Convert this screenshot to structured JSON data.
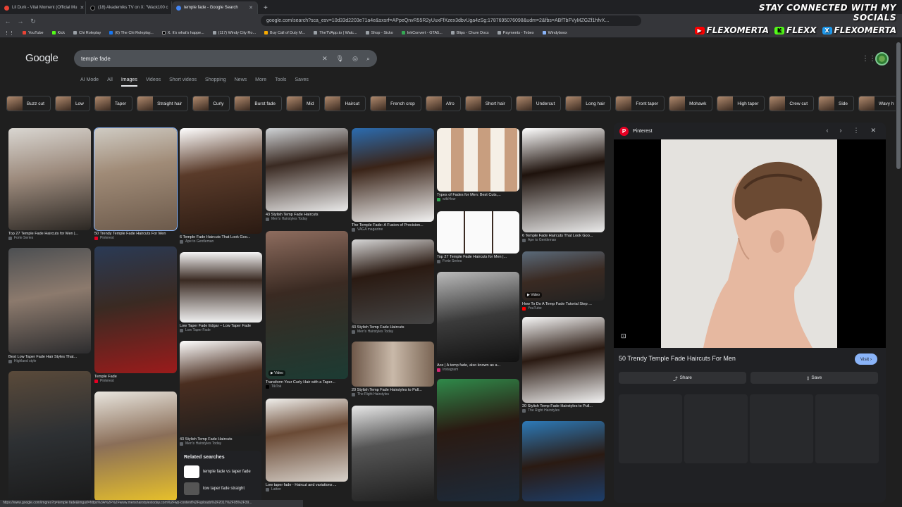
{
  "browser": {
    "tabs": [
      {
        "title": "Lil Durk - Vital Moment (Official Mu",
        "icon": "youtube-icon"
      },
      {
        "title": "(18) Akademiks TV on X: \"Wack100 c",
        "icon": "x-icon"
      },
      {
        "title": "temple fade - Google Search",
        "icon": "google-icon",
        "active": true
      }
    ],
    "url": "google.com/search?sca_esv=10d33d2203e71a4e&sxsrf=APpeQnvR55R2yUuxFfXzex3dbvUga4zSg:1787695076098&udm=2&fbs=ABfTbFVyMZGZf1hfvX...",
    "bookmarks": [
      "YouTube",
      "Kick",
      "Chi Roleplay",
      "(6) The Chi Roleplay...",
      "X. It's what's happe...",
      "(117) Windy City Ro...",
      "Buy Call of Duty M...",
      "TheTVApp.to | Watc...",
      "Shop - Sicko",
      "InkConvert - GTA5...",
      "Blips - Chure Docs",
      "Payments - Tebex",
      "Windyboox"
    ],
    "status_url": "https://www.google.com/imgres?q=temple fade&imgurl=https%3A%2F%2Fwww.menshairstylestoday.com%2Fwp-content%2Fuploads%2F2017%2F05%2F39..."
  },
  "overlay": {
    "top": "STAY CONNECTED WITH MY SOCIALS",
    "youtube": "FLEXOMERTA",
    "kick": "FLEXX",
    "x": "FLEXOMERTA"
  },
  "google": {
    "logo": "Google",
    "query": "temple fade",
    "nav": [
      "AI Mode",
      "All",
      "Images",
      "Videos",
      "Short videos",
      "Shopping",
      "News",
      "More",
      "Tools",
      "Saves"
    ],
    "chips": [
      "Buzz cut",
      "Low",
      "Taper",
      "Straight hair",
      "Curly",
      "Burst fade",
      "Mid",
      "Haircut",
      "French crop",
      "Afro",
      "Short hair",
      "Undercut",
      "Long hair",
      "Front taper",
      "Mohawk",
      "High taper",
      "Crew cut",
      "Side",
      "Wavy h"
    ]
  },
  "results": [
    {
      "cap": "Top 27 Temple Fade Haircuts for Men |...",
      "src": "Forte Series"
    },
    {
      "cap": "50 Trendy Temple Fade Haircuts For Men",
      "src": "Pinterest"
    },
    {
      "cap": "6 Temple Fade Haircuts That Look Goo...",
      "src": "Ape to Gentleman"
    },
    {
      "cap": "43 Stylish Temp Fade Haircuts",
      "src": "Men's Hairstyles Today"
    },
    {
      "cap": "The Temple Fade: A Fusion of Precision...",
      "src": "VAGA magazine"
    },
    {
      "cap": "Types of Fades for Men: Best Cuts,...",
      "src": "wikiHow"
    },
    {
      "cap": "6 Temple Fade Haircuts That Look Goo...",
      "src": "Ape to Gentleman"
    },
    {
      "cap": "Best Low Taper Fade Hair Styles That...",
      "src": "Highland style"
    },
    {
      "cap": "Temple Fade",
      "src": "Pinterest"
    },
    {
      "cap": "Low Taper Fade Edgar – Low Taper Fade",
      "src": "Low Taper Fade"
    },
    {
      "cap": "Transform Your Curly Hair with a Taper...",
      "src": "TikTok"
    },
    {
      "cap": "43 Stylish Temp Fade Haircuts",
      "src": "Men's Hairstyles Today"
    },
    {
      "cap": "Top 27 Temple Fade Haircuts for Men |...",
      "src": "Forte Series"
    },
    {
      "cap": "How To Do A Temp Fade Tutorial Step ...",
      "src": "YouTube"
    },
    {
      "cap": "43 Stylish Temp Fade Haircuts",
      "src": "Men's Hairstyles Today"
    },
    {
      "cap": "20 Stylish Temp Fade Hairstyles to Pull...",
      "src": "The Right Hairstyles"
    },
    {
      "cap": "Ace | A temp fade, also known as a...",
      "src": "Instagram"
    },
    {
      "cap": "20 Stylish Temp Fade Hairstyles to Pull...",
      "src": "The Right Hairstyles"
    },
    {
      "cap": "Low taper fade - Haircut and variations ...",
      "src": "Latten"
    }
  ],
  "related": {
    "title": "Related searches",
    "items": [
      "temple fade vs taper fade",
      "low taper fade straight"
    ]
  },
  "preview": {
    "source": "Pinterest",
    "title": "50 Trendy Temple Fade Haircuts For Men",
    "visit": "Visit",
    "share": "Share",
    "save": "Save"
  },
  "video_badge": "Video"
}
